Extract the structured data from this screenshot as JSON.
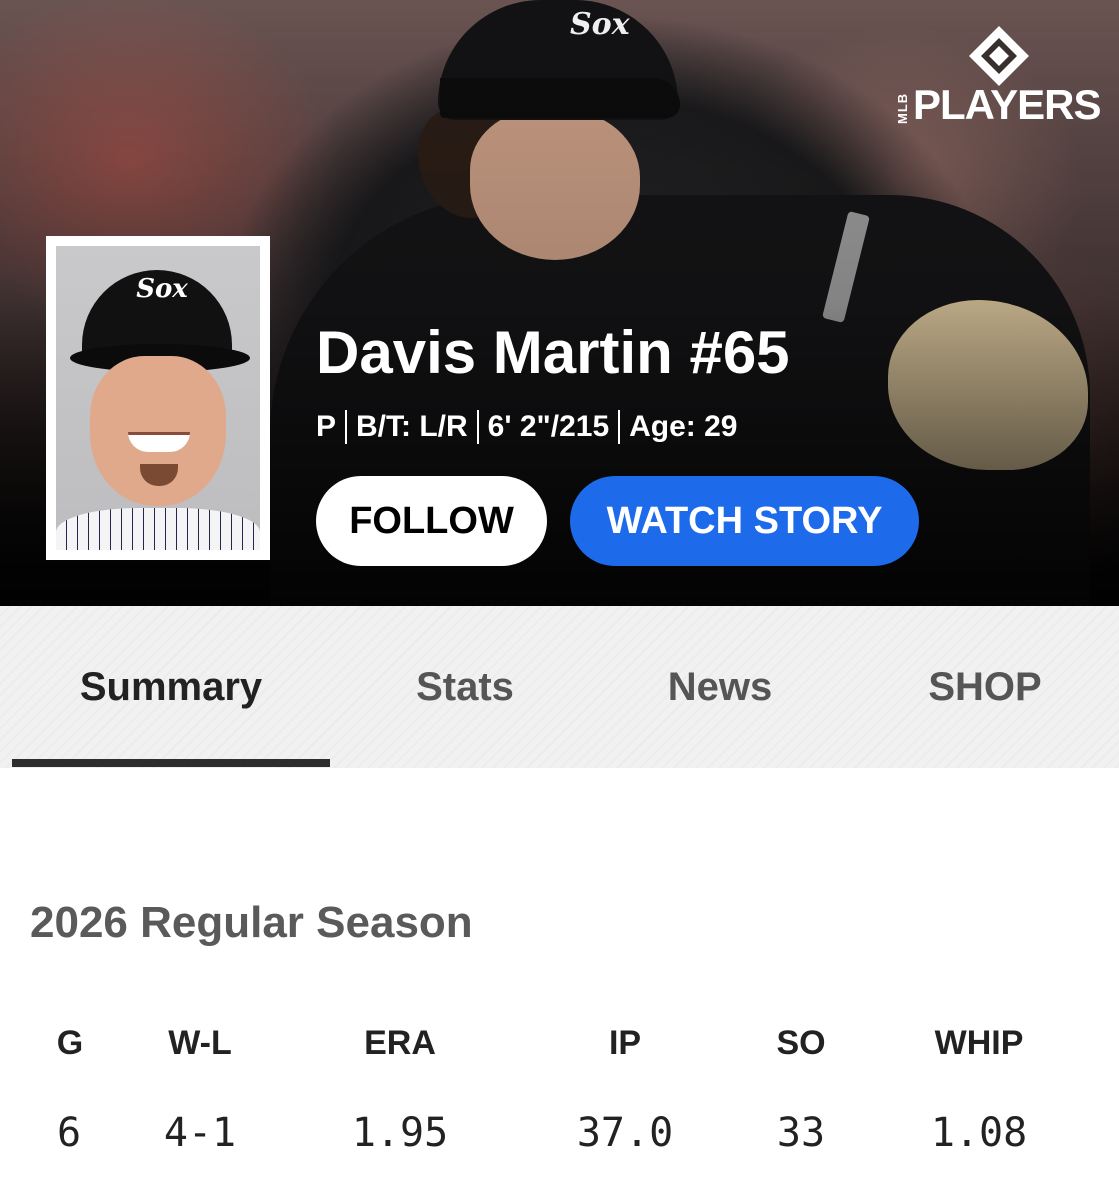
{
  "header": {
    "brand_mlb": "MLB",
    "brand_word": "PLAYERS",
    "player_name": "Davis Martin #65",
    "position": "P",
    "bats_throws": "B/T: L/R",
    "height_weight": "6' 2\"/215",
    "age": "Age: 29",
    "cap_logo": "Sox",
    "follow_label": "FOLLOW",
    "watch_label": "WATCH STORY",
    "colors": {
      "watch_button": "#1d6bea",
      "follow_button": "#ffffff"
    }
  },
  "tabs": [
    {
      "label": "Summary",
      "active": true
    },
    {
      "label": "Stats",
      "active": false
    },
    {
      "label": "News",
      "active": false
    },
    {
      "label": "SHOP",
      "active": false
    }
  ],
  "season": {
    "title": "2026 Regular Season",
    "headers": [
      "G",
      "W-L",
      "ERA",
      "IP",
      "SO",
      "WHIP"
    ],
    "values": [
      "6",
      "4-1",
      "1.95",
      "37.0",
      "33",
      "1.08"
    ]
  }
}
